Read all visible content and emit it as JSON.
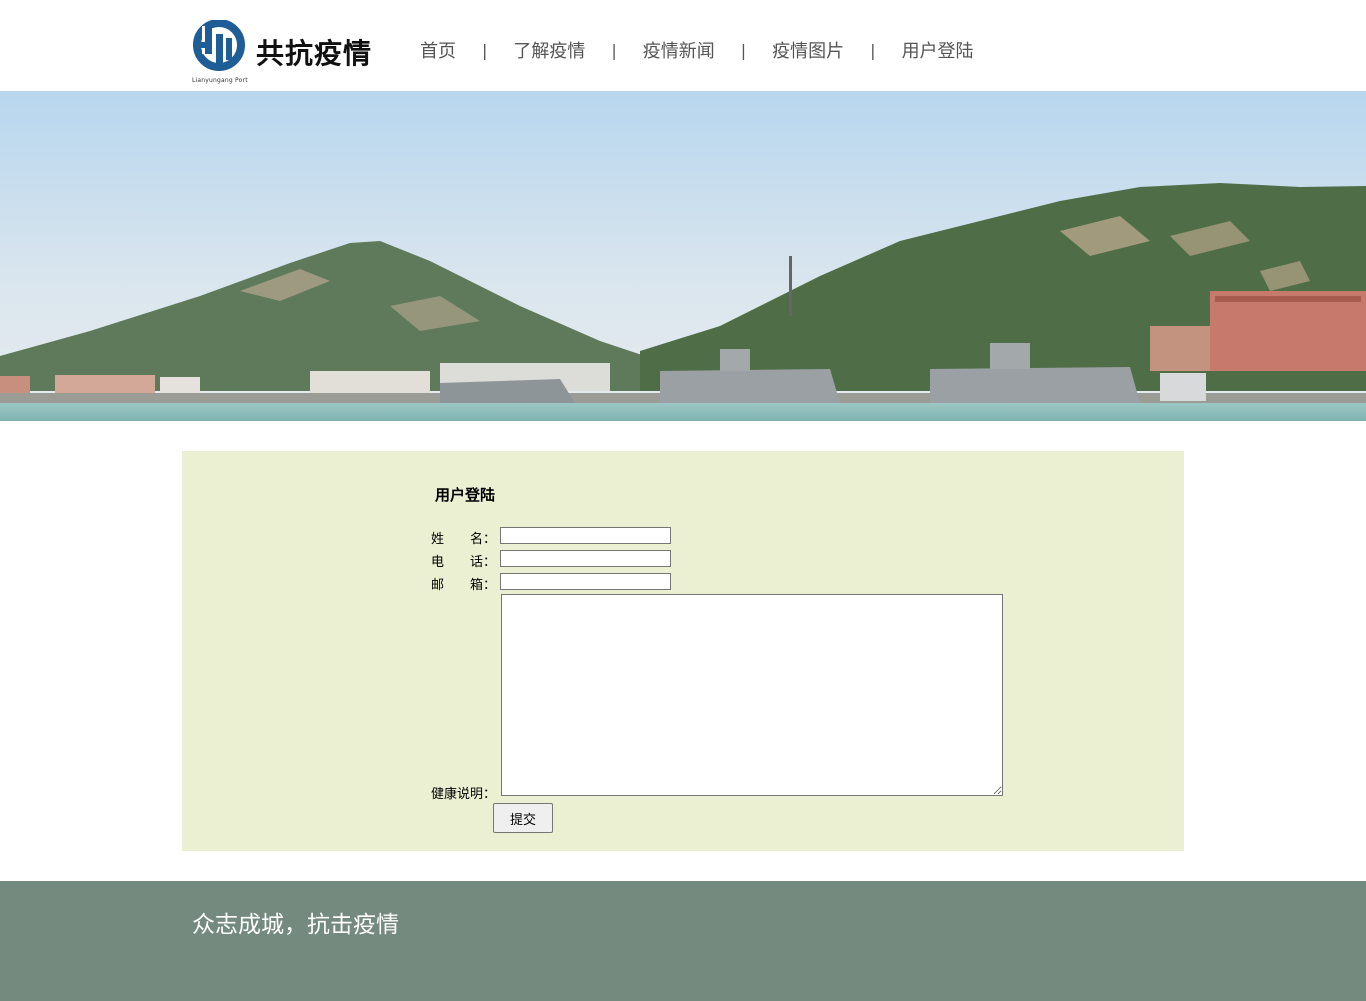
{
  "header": {
    "logo_text": "共抗疫情",
    "logo_sub": "Lianyungang Port",
    "brand_color": "#1f5d96"
  },
  "nav": {
    "items": [
      {
        "label": "首页"
      },
      {
        "label": "了解疫情"
      },
      {
        "label": "疫情新闻"
      },
      {
        "label": "疫情图片"
      },
      {
        "label": "用户登陆"
      }
    ],
    "separator": "|"
  },
  "form": {
    "title": "用户登陆",
    "name_label": "姓　　名：",
    "phone_label": "电　　话：",
    "email_label": "邮　　箱：",
    "health_label": "健康说明：",
    "name_value": "",
    "phone_value": "",
    "email_value": "",
    "health_value": "",
    "submit_label": "提交",
    "panel_color": "#ecf0d3"
  },
  "footer": {
    "slogan": "众志成城，抗击疫情",
    "bg_color": "#748a7e"
  }
}
